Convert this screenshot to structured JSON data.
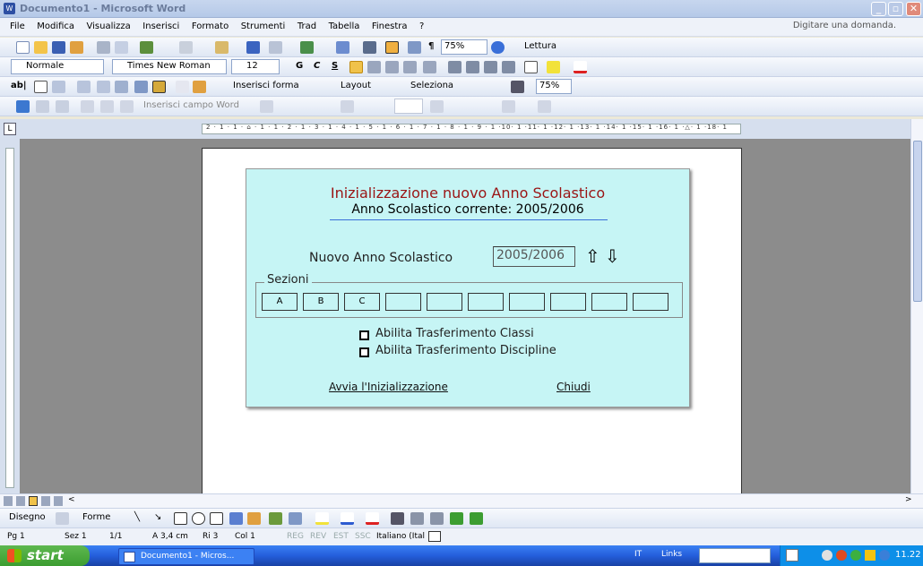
{
  "window": {
    "title": "Documento1 - Microsoft Word"
  },
  "menu": {
    "items": [
      "File",
      "Modifica",
      "Visualizza",
      "Inserisci",
      "Formato",
      "Strumenti",
      "Trad",
      "Tabella",
      "Finestra",
      "?"
    ],
    "help_placeholder": "Digitare una domanda."
  },
  "toolbar_std": {
    "zoom": "75%",
    "reading": "Lettura"
  },
  "toolbar_fmt": {
    "style": "Normale",
    "font": "Times New Roman",
    "size": "12",
    "bold": "G",
    "italic": "C",
    "underline": "S"
  },
  "toolbar_ctl": {
    "insert_form": "Inserisci forma",
    "layout": "Layout",
    "select": "Seleziona",
    "zoom": "75%"
  },
  "toolbar_mail": {
    "insert_field": "Inserisci campo Word"
  },
  "ruler": {
    "numbers": "2 · 1 · 1 · ⌂ · 1 · 1 · 2 · 1 · 3 · 1 · 4 · 1 · 5 · 1 · 6 · 1 · 7 · 1 · 8 · 1 · 9 · 1 ·10· 1 ·11· 1 ·12· 1 ·13· 1 ·14· 1 ·15· 1 ·16· 1 ·△· 1 ·18· 1"
  },
  "form": {
    "title": "Inizializzazione nuovo Anno Scolastico",
    "subtitle": "Anno Scolastico corrente: 2005/2006",
    "new_year_label": "Nuovo Anno Scolastico",
    "new_year_value": "2005/2006",
    "sections_label": "Sezioni",
    "sections": [
      "A",
      "B",
      "C",
      "",
      "",
      "",
      "",
      "",
      "",
      ""
    ],
    "chk_classi": "Abilita Trasferimento Classi",
    "chk_discipline": "Abilita Trasferimento Discipline",
    "start_link": "Avvia l'Inizializzazione",
    "close_link": "Chiudi"
  },
  "drawbar": {
    "draw": "Disegno",
    "shapes": "Forme"
  },
  "status": {
    "page": "Pg 1",
    "section": "Sez 1",
    "pages": "1/1",
    "at": "A 3,4 cm",
    "line": "Ri 3",
    "col": "Col 1",
    "rec": "REG",
    "rev": "REV",
    "ext": "EST",
    "ovr": "SSC",
    "lang": "Italiano (Ital"
  },
  "taskbar": {
    "start": "start",
    "task": "Documento1 - Micros...",
    "lang": "IT",
    "links": "Links",
    "clock": "11.22"
  }
}
